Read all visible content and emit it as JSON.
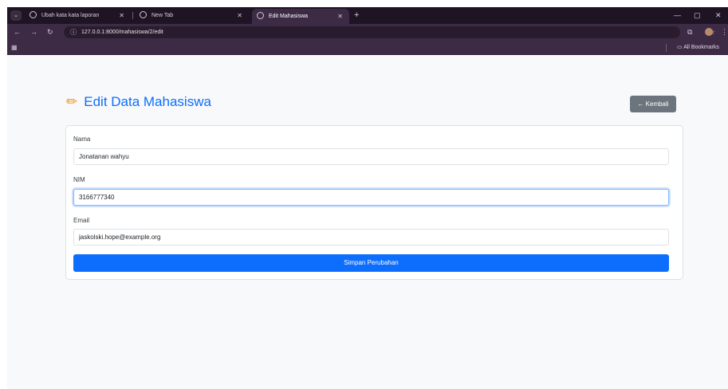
{
  "browser": {
    "tabs": [
      {
        "title": "Ubah kata kata laporan",
        "active": false
      },
      {
        "title": "New Tab",
        "active": false
      },
      {
        "title": "Edit Mahasiswa",
        "active": true
      }
    ],
    "url": "127.0.0.1:8000/mahasiswa/2/edit",
    "bookmarks_label": "All Bookmarks"
  },
  "page": {
    "title": "Edit Data Mahasiswa",
    "back_button": "← Kembali",
    "form": {
      "nama_label": "Nama",
      "nama_value": "Jonatanan wahyu",
      "nim_label": "NIM",
      "nim_value": "3166777340",
      "email_label": "Email",
      "email_value": "jaskolski.hope@example.org",
      "submit_label": "Simpan Perubahan"
    }
  },
  "colors": {
    "primary": "#0d6efd",
    "secondary": "#6c757d",
    "browser_frame": "#3d2b45",
    "title_icon": "#f08c1c"
  }
}
